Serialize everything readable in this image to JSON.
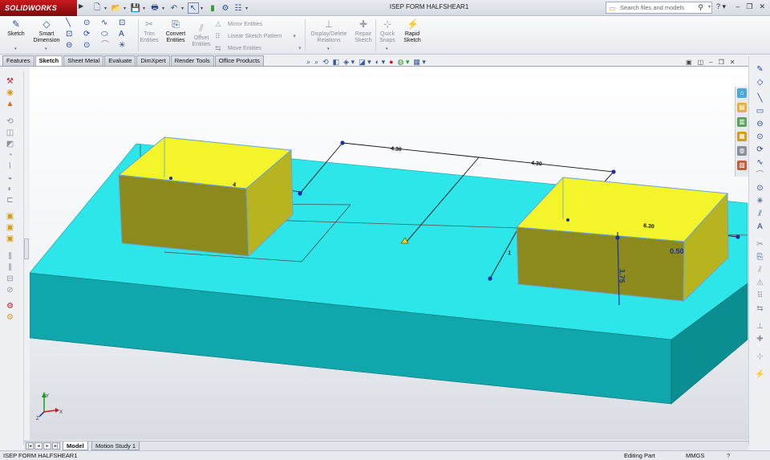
{
  "app": {
    "logo": "SOLIDWORKS",
    "title": "ISEP FORM HALFSHEAR1"
  },
  "search": {
    "placeholder": "Search files and models"
  },
  "commands": {
    "sketch": "Sketch",
    "smart_dimension_1": "Smart",
    "smart_dimension_2": "Dimension",
    "trim_1": "Trim",
    "trim_2": "Entities",
    "convert_1": "Convert",
    "convert_2": "Entities",
    "offset_1": "Offset",
    "offset_2": "Entities",
    "mirror": "Mirror Entities",
    "linear_pattern": "Linear Sketch Pattern",
    "move": "Move Entities",
    "display_delete_1": "Display/Delete",
    "display_delete_2": "Relations",
    "repair_1": "Repair",
    "repair_2": "Sketch",
    "quick_1": "Quick",
    "quick_2": "Snaps",
    "rapid_1": "Rapid",
    "rapid_2": "Sketch"
  },
  "tabs": [
    "Features",
    "Sketch",
    "Sheet Metal",
    "Evaluate",
    "DimXpert",
    "Render Tools",
    "Office Products"
  ],
  "active_tab": "Sketch",
  "dimensions": {
    "d1": "4.30",
    "d2": "4.30",
    "d3": "6.30",
    "d4": "4",
    "d5": "1.75",
    "d6": "0.50",
    "d7": "1"
  },
  "bottom_tabs": [
    "Model",
    "Motion Study 1"
  ],
  "status": {
    "doc": "ISEP FORM HALFSHEAR1",
    "mode": "Editing Part",
    "units": "MMGS",
    "help": "?"
  },
  "colors": {
    "base_top": "#2de6ea",
    "base_front": "#0fa3a8",
    "block_top": "#f4f42a",
    "block_side": "#8c8a1c",
    "accent": "#c7191f"
  }
}
